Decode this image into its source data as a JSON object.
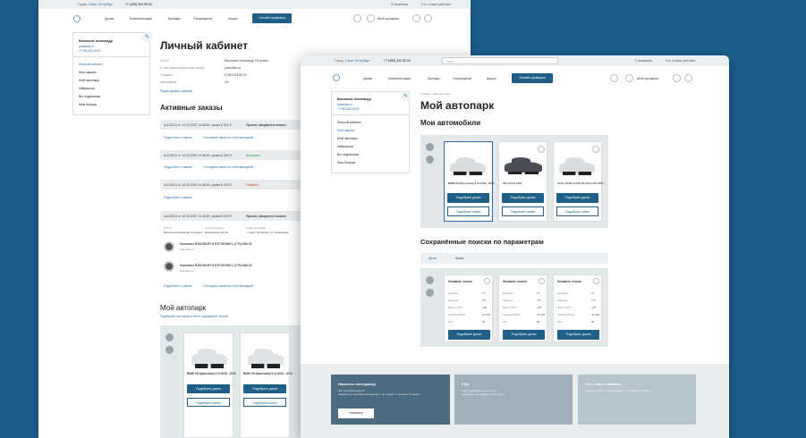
{
  "back": {
    "topbar": {
      "city_prefix": "Город:",
      "city": "Санкт-Петербург",
      "phone": "+7 (495) 332 55 33",
      "company": "О компании",
      "about": "Что с нами работает"
    },
    "nav": {
      "items": [
        "Диски",
        "Комплектации",
        "Бренды",
        "Популярное",
        "Акции"
      ],
      "cta": "Онлайн-примерка",
      "profile": "Мой профиль"
    },
    "user": {
      "name": "Васильев Александр",
      "email": "ywdsdfsd.ru",
      "phone": "+7 950 823 58 92"
    },
    "menu": [
      "Личный кабинет",
      "Мои заказы",
      "Мой автопарк",
      "Избранное",
      "Вы подписаны",
      "Мои бонусы"
    ],
    "title": "Личный кабинет",
    "info": {
      "labels": [
        "Ф.И.О.",
        "E-mail (используется как логин)",
        "Телефон",
        "Автопарков"
      ],
      "values": [
        "Васильев Александр Петрович",
        "ywdsdfsd.ru",
        "8 950 823 58 92",
        "4/4"
      ],
      "edit": "Редактировать данные"
    },
    "orders_title": "Активные заказы",
    "orders": [
      {
        "head": "№123013 от 10.03.2020  14:48:15,  сумма 8 400 ₽",
        "status": "Принят, ожидается оплата",
        "a": "Подробнее о заказе",
        "b": "Отследить заказ по этой накладной"
      },
      {
        "head": "№123013 от 10.03.2020  14:48:15,  сумма 8 400 ₽",
        "status": "Выполнен",
        "a": "Подробнее о заказе",
        "b": "Отследить заказ по этой накладной"
      },
      {
        "head": "№123013 от 10.03.2020  14:48:15,  сумма 8 400 ₽",
        "status": "Отменён",
        "a": "Подробнее о заказе",
        "b": ""
      },
      {
        "head": "№123013 от 10.03.2020  14:48:15,  сумма 8 400 ₽",
        "status": "Принят, ожидается оплата",
        "a": "",
        "b": ""
      }
    ],
    "order_detail": {
      "cols": [
        "Ф.И.О.",
        "Способ оплаты",
        "Адрес доставки"
      ],
      "vals": [
        "Васильев Александр Петрович",
        "Банковской картой",
        "г. Санкт-Петербург, ул. Сиреневая"
      ],
      "items": [
        {
          "name": "Комплект R15/208 ET 6.5 ET45 D66.1 (770) D65.23",
          "sub": "Ожидается"
        },
        {
          "name": "Комплект R15/208 ET 6.5 ET45 D66.1 (770) D65.23",
          "sub": "Ожидается"
        }
      ],
      "a": "Подробнее о заказе",
      "b": "Отследить заказ по этой накладной"
    },
    "fleet_title": "Мой автопарк",
    "fleet_link": "Подберите все шины и все в ожидаемой на мой",
    "cars": [
      {
        "name": "BMW X6 Кроссовер 5 3I 2008 - 2019",
        "btn1": "Подобрать диски",
        "btn2": "Подобрать шины"
      },
      {
        "name": "BMW X6 Кроссовер 5 3I 2008 - 2019",
        "btn1": "Подобрать диски",
        "btn2": "Подобрать шины"
      }
    ]
  },
  "front": {
    "topbar": {
      "city_prefix": "Город:",
      "city": "Санкт-Петербург",
      "phone": "+7 (495) 332 55 33",
      "search": "Поиск",
      "company": "О компании",
      "about": "Что с нами работает"
    },
    "nav": {
      "items": [
        "Диски",
        "Комплектации",
        "Бренды",
        "Популярное",
        "Акции"
      ],
      "cta": "Онлайн-примерка",
      "profile": "Мой профиль"
    },
    "breadcrumb": "Главная · Мой автопарк",
    "title": "Мой автопарк",
    "user": {
      "name": "Васильев Александр",
      "email": "ywdsdfsd.ru",
      "phone": "+7 950 823 58 92"
    },
    "menu": [
      "Личный кабинет",
      "Мои заказы",
      "Мой автопарк",
      "Избранное",
      "Вы подписаны",
      "Мои бонусы"
    ],
    "cars_title": "Мои автомобили",
    "cars": [
      {
        "name": "BMW X6 Кроссовер 5 3I 2008 - 2019",
        "btn1": "Подобрать диски",
        "btn2": "Подобрать шины"
      },
      {
        "name": "KIA Cee'd 2021",
        "btn1": "Подобрать диски",
        "btn2": "Подобрать шины"
      },
      {
        "name": "Volvo XC90 II (V78 R1 Volvo XC 2017",
        "btn1": "Подобрать диски",
        "btn2": "Подобрать шины"
      }
    ],
    "searches_title": "Сохранённые поиски по параметрам",
    "tabs": [
      "Диски",
      "Шины"
    ],
    "search_cards": [
      {
        "title": "Название поиска",
        "rows": [
          [
            "Диаметр",
            "17"
          ],
          [
            "Ширина",
            "7.5"
          ],
          [
            "Вылет (ET)",
            "+35"
          ],
          [
            "Крепёж (PCD)",
            "4х 100"
          ],
          [
            "DIA",
            "60"
          ]
        ],
        "btn": "Подобрать диски"
      },
      {
        "title": "Название поиска",
        "rows": [
          [
            "Диаметр",
            "17"
          ],
          [
            "Ширина",
            "7.5"
          ],
          [
            "Вылет (ET)",
            "+35"
          ],
          [
            "Крепёж (PCD)",
            "4х 100"
          ],
          [
            "DIA",
            "60"
          ]
        ],
        "btn": "Подобрать диски"
      },
      {
        "title": "Название поиска",
        "rows": [
          [
            "Диаметр",
            "17"
          ],
          [
            "Ширина",
            "7.5"
          ],
          [
            "Вылет (ET)",
            "+35"
          ],
          [
            "Крепёж (PCD)",
            "4х 100"
          ],
          [
            "DIA",
            "60"
          ]
        ],
        "btn": "Подобрать диски"
      }
    ],
    "footer": [
      {
        "title": "Написать менеджеру",
        "text": "Это срочный вопрос?\nЗадайте его нашему менеджеру, и он ответит в течение 15 минут",
        "btn": "Написать"
      },
      {
        "title": "FAQ",
        "text": "Часто задаваемые вопросы.\nНаверняка вы найдёте ответ здесь"
      },
      {
        "title": "Что с нами заказами",
        "text": "Обычно заказы обрабатываются в течение 15 минут"
      }
    ]
  },
  "colors": {
    "bg": "#1c5f8d",
    "accent": "#1f5e86",
    "status_ok": "#3a9d3a",
    "status_cancel": "#d33b2b"
  }
}
